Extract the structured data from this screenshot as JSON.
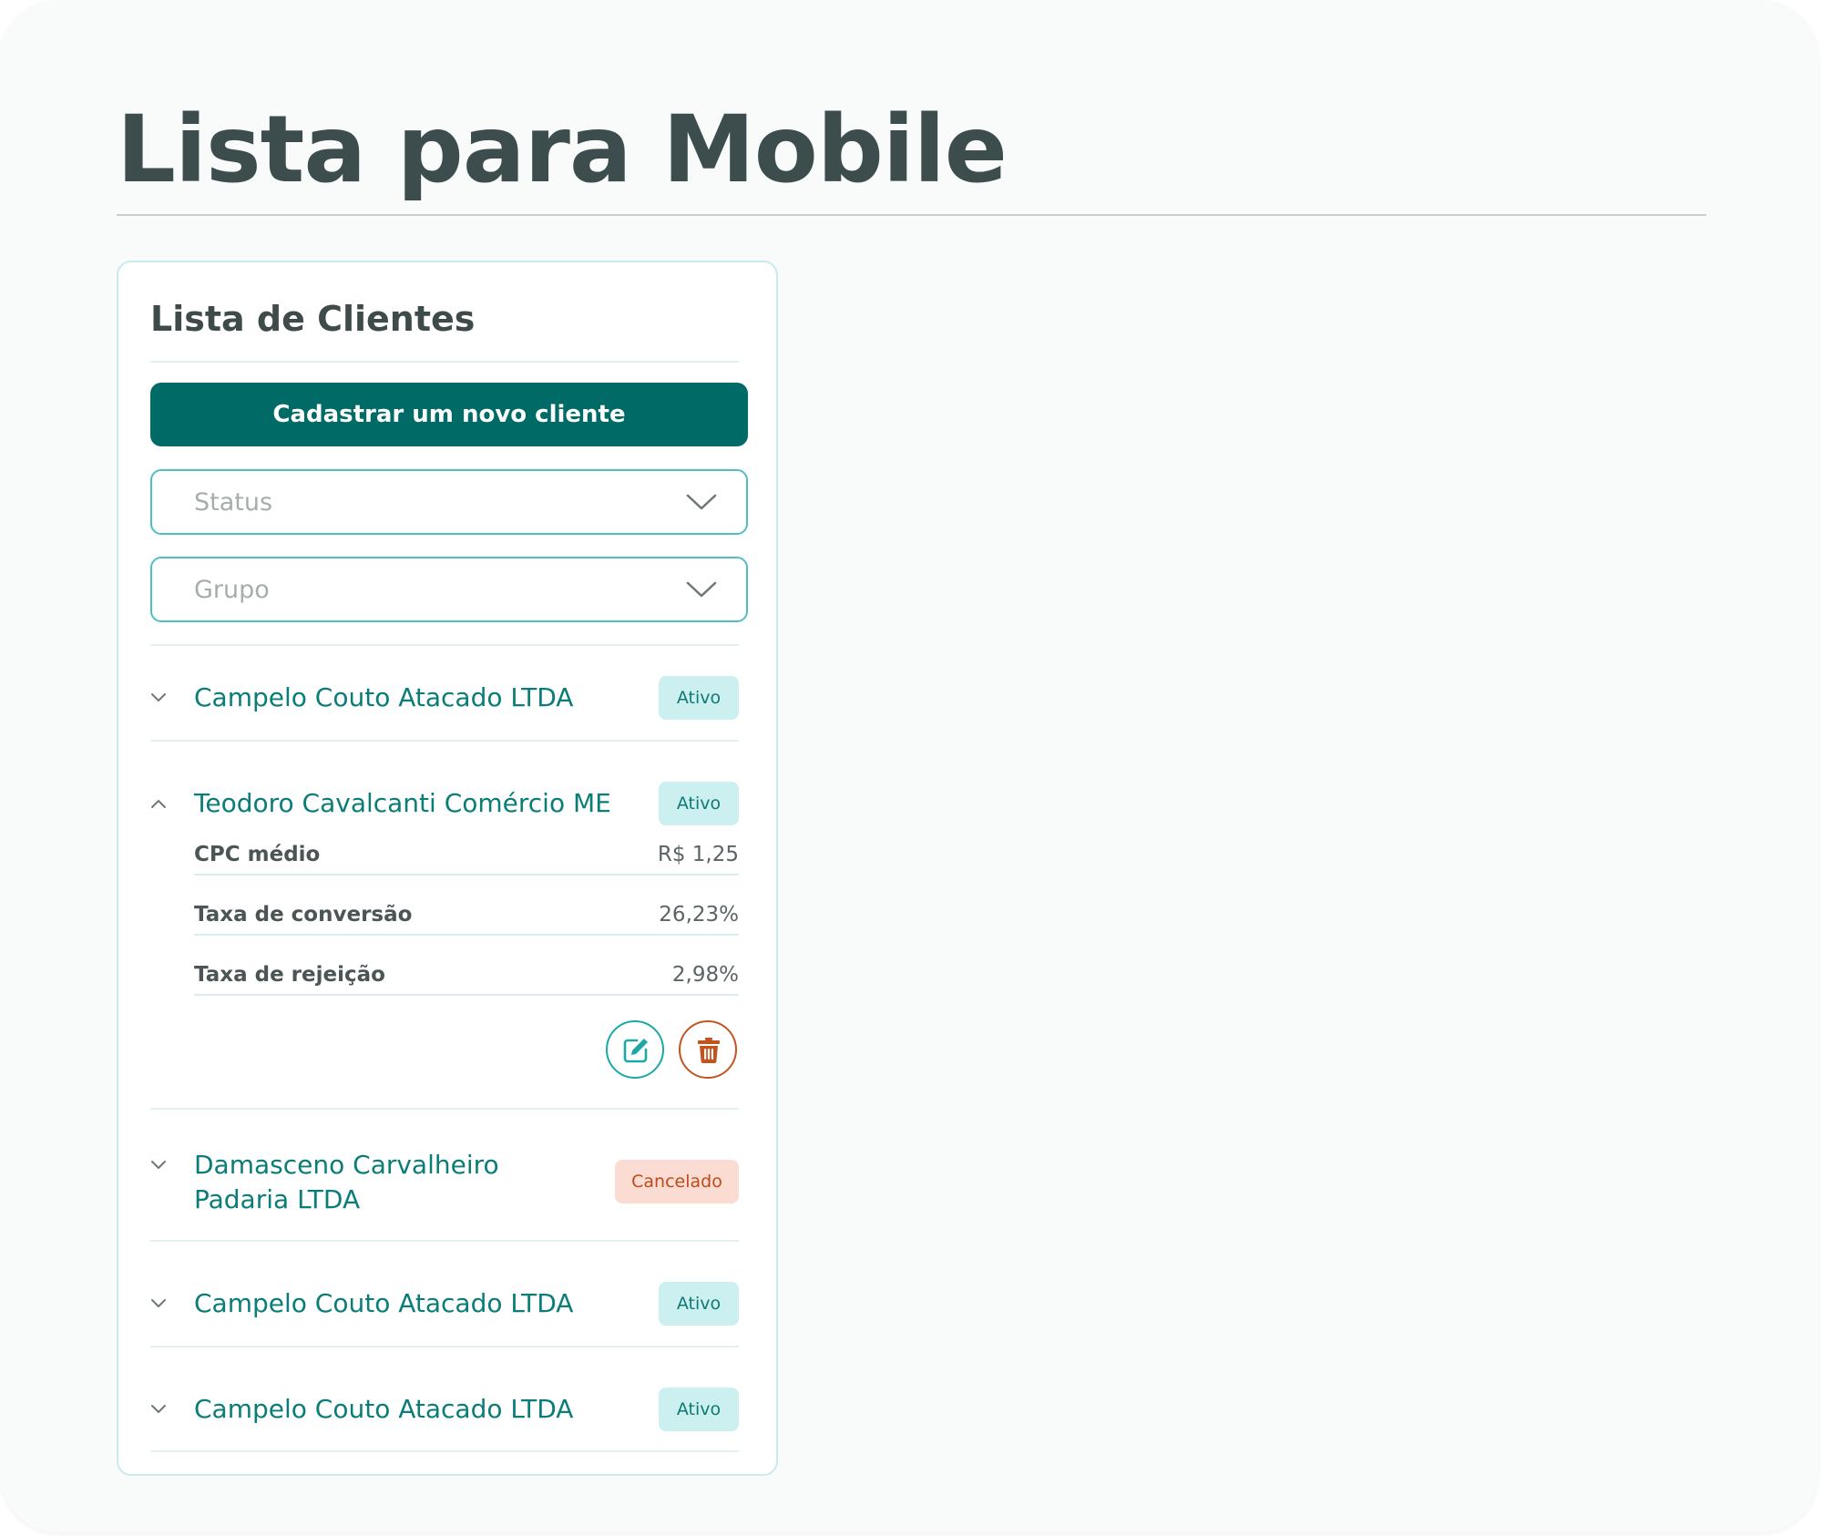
{
  "page": {
    "title": "Lista para Mobile"
  },
  "card": {
    "title": "Lista de Clientes",
    "new_client_button": "Cadastrar um novo cliente",
    "filters": {
      "status_placeholder": "Status",
      "group_placeholder": "Grupo"
    }
  },
  "clients": [
    {
      "name": "Campelo Couto Atacado LTDA",
      "status": "Ativo",
      "expanded": false
    },
    {
      "name": "Teodoro Cavalcanti Comércio ME",
      "status": "Ativo",
      "expanded": true,
      "details": [
        {
          "label": "CPC médio",
          "value": "R$ 1,25"
        },
        {
          "label": "Taxa de conversão",
          "value": "26,23%"
        },
        {
          "label": "Taxa de rejeição",
          "value": "2,98%"
        }
      ]
    },
    {
      "name_line1": "Damasceno Carvalheiro",
      "name_line2": "Padaria LTDA",
      "status": "Cancelado",
      "expanded": false
    },
    {
      "name": "Campelo Couto Atacado LTDA",
      "status": "Ativo",
      "expanded": false
    },
    {
      "name": "Campelo Couto Atacado LTDA",
      "status": "Ativo",
      "expanded": false
    }
  ],
  "icons": {
    "select_chevron": "chevron-down-icon",
    "row_collapsed": "chevron-down-icon",
    "row_expanded": "chevron-up-icon",
    "edit": "edit-icon",
    "delete": "trash-icon"
  },
  "colors": {
    "primary": "#006b66",
    "accent": "#1aa9a6",
    "active_badge_bg": "#ccefef",
    "cancelled_badge_bg": "#fbdcd2",
    "danger": "#c4541e",
    "title_text": "#3d4d4e"
  }
}
